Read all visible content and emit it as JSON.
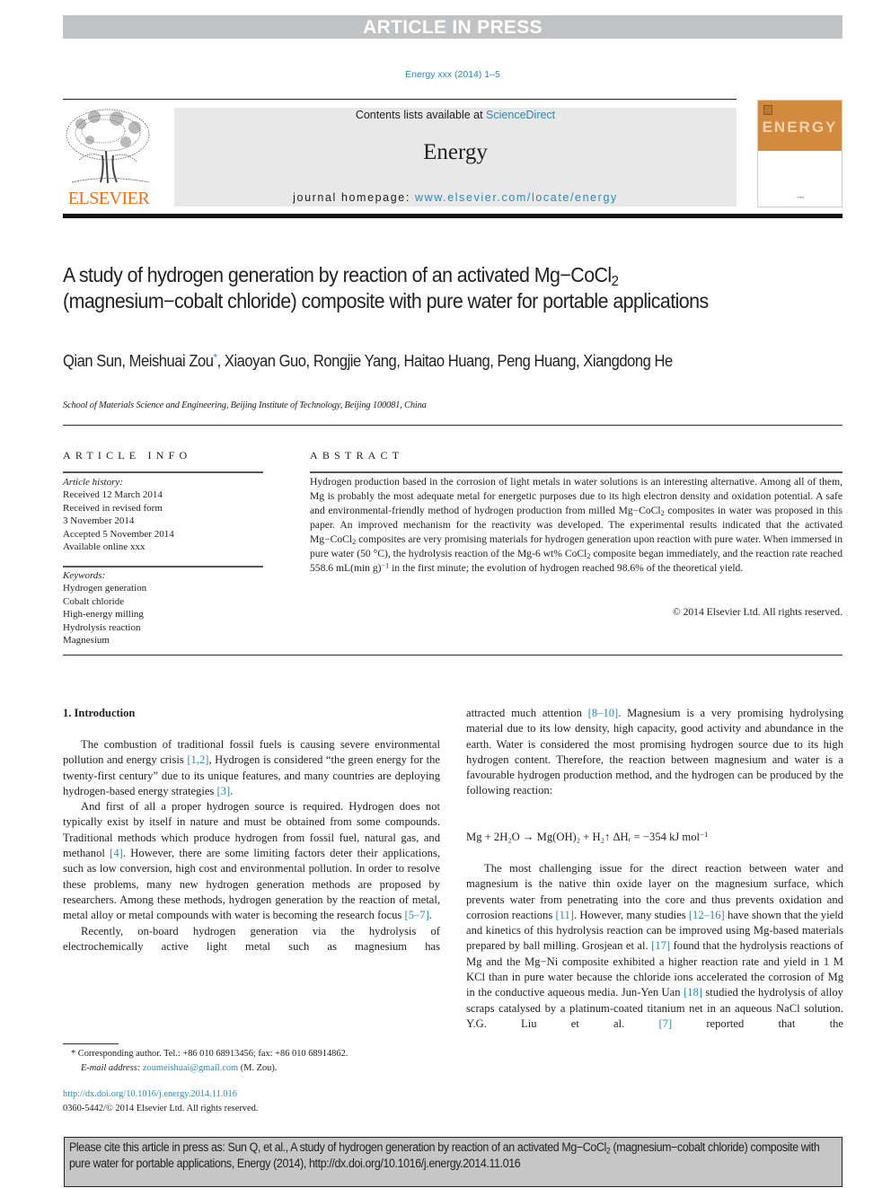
{
  "banner": {
    "label": "ARTICLE IN PRESS"
  },
  "journal_ref": "Energy xxx (2014) 1–5",
  "masthead": {
    "contents_prefix": "Contents lists available at ",
    "contents_link": "ScienceDirect",
    "journal_name": "Energy",
    "homepage_prefix": "journal homepage: ",
    "homepage_link": "www.elsevier.com/locate/energy",
    "publisher_logo": "ELSEVIER",
    "cover_word": "ENERGY",
    "brand_colors": {
      "elsevier_orange": "#e9711c",
      "link_blue": "#2a8ab8",
      "cover_orange": "#d28a3e"
    }
  },
  "article": {
    "title_part1": "A study of hydrogen generation by reaction of an activated Mg−CoCl",
    "title_sub": "2",
    "title_part2": " (magnesium−cobalt chloride) composite with pure water for portable applications",
    "authors_before": "Qian Sun, Meishuai Zou",
    "corresponding_mark": "*",
    "authors_after": ", Xiaoyan Guo, Rongjie Yang, Haitao Huang, Peng Huang, Xiangdong He",
    "affiliation": "School of Materials Science and Engineering, Beijing Institute of Technology, Beijing 100081, China"
  },
  "article_info": {
    "heading": "ARTICLE INFO",
    "history_label": "Article history:",
    "history": [
      "Received 12 March 2014",
      "Received in revised form",
      "3 November 2014",
      "Accepted 5 November 2014",
      "Available online xxx"
    ],
    "keywords_label": "Keywords:",
    "keywords": [
      "Hydrogen generation",
      "Cobalt chloride",
      "High-energy milling",
      "Hydrolysis reaction",
      "Magnesium"
    ]
  },
  "abstract": {
    "heading": "ABSTRACT",
    "s1": "Hydrogen production based in the corrosion of light metals in water solutions is an interesting alternative. Among all of them, Mg is probably the most adequate metal for energetic purposes due to its high electron density and oxidation potential. A safe and environmental-friendly method of hydrogen production from milled Mg−CoCl",
    "s2": " composites in water was proposed in this paper. An improved mechanism for the reactivity was developed. The experimental results indicated that the activated Mg−CoCl",
    "s3": " composites are very promising materials for hydrogen generation upon reaction with pure water. When immersed in pure water (50 °C), the hydrolysis reaction of the Mg-6 wt% CoCl",
    "s4": " composite began immediately, and the reaction rate reached 558.6 mL(min g)",
    "s4_sup": "−1",
    "s5": " in the first minute; the evolution of hydrogen reached 98.6% of the theoretical yield.",
    "sub2": "2",
    "copyright": "© 2014 Elsevier Ltd. All rights reserved."
  },
  "intro": {
    "heading": "1.  Introduction",
    "p1a": "The combustion of traditional fossil fuels is causing severe environmental pollution and energy crisis ",
    "ref_1_2": "[1,2]",
    "p1b": ", Hydrogen is considered “the green energy for the twenty-first century” due to its unique features, and many countries are deploying hydrogen-based energy strategies ",
    "ref_3": "[3]",
    "p2a": "And first of all a proper hydrogen source is required. Hydrogen does not typically exist by itself in nature and must be obtained from some compounds. Traditional methods which produce hydrogen from fossil fuel, natural gas, and methanol ",
    "ref_4": "[4]",
    "p2b": ". However, there are some limiting factors deter their applications, such as low conversion, high cost and environmental pollution. In order to resolve these problems, many new hydrogen generation methods are proposed by researchers. Among these methods, hydrogen generation by the reaction of metal, metal alloy or metal compounds with water is becoming the research focus ",
    "ref_5_7": "[5–7]",
    "p3": "Recently, on-board hydrogen generation via the hydrolysis of electrochemically active light metal such as magnesium has",
    "r1a": "attracted much attention ",
    "ref_8_10": "[8–10]",
    "r1b": ". Magnesium is a very promising hydrolysing material due to its low density, high capacity, good activity and abundance in the earth. Water is considered the most promising hydrogen source due to its high hydrogen content. Therefore, the reaction between magnesium and water is a favourable hydrogen production method, and the hydrogen can be produced by the following reaction:",
    "equation": "Mg + 2H₂O → Mg(OH)₂ + H₂↑ ΔHᵣ = −354 kJ mol",
    "equation_sup": "−1",
    "r2a": "The most challenging issue for the direct reaction between water and magnesium is the native thin oxide layer on the magnesium surface, which prevents water from penetrating into the core and thus prevents oxidation and corrosion reactions ",
    "ref_11": "[11]",
    "r2b": ". However, many studies ",
    "ref_12_16": "[12–16]",
    "r2c": " have shown that the yield and kinetics of this hydrolysis reaction can be improved using Mg-based materials prepared by ball milling. Grosjean et al. ",
    "ref_17": "[17]",
    "r2d": " found that the hydrolysis reactions of Mg and the Mg−Ni composite exhibited a higher reaction rate and yield in 1 M KCl than in pure water because the chloride ions accelerated the corrosion of Mg in the conductive aqueous media. Jun-Yen Uan ",
    "ref_18": "[18]",
    "r2e": " studied the hydrolysis of alloy scraps catalysed by a platinum-coated titanium net in an aqueous NaCl solution. Y.G. Liu et al. ",
    "ref_7": "[7]",
    "r2f": " reported that the"
  },
  "footnote": {
    "mark": "*",
    "text": " Corresponding author. Tel.: +86 010 68913456; fax: +86 010 68914862.",
    "email_label": "E-mail address: ",
    "email": "zoumeishuai@gmail.com",
    "email_suffix": " (M. Zou)."
  },
  "doi": {
    "link": "http://dx.doi.org/10.1016/j.energy.2014.11.016",
    "issn_line": "0360-5442/© 2014 Elsevier Ltd. All rights reserved."
  },
  "citation_box": {
    "part1": "Please cite this article in press as: Sun Q, et al., A study of hydrogen generation by reaction of an activated Mg−CoCl",
    "sub": "2",
    "part2": " (magnesium−cobalt chloride) composite with pure water for portable applications, Energy (2014), http://dx.doi.org/10.1016/j.energy.2014.11.016"
  }
}
